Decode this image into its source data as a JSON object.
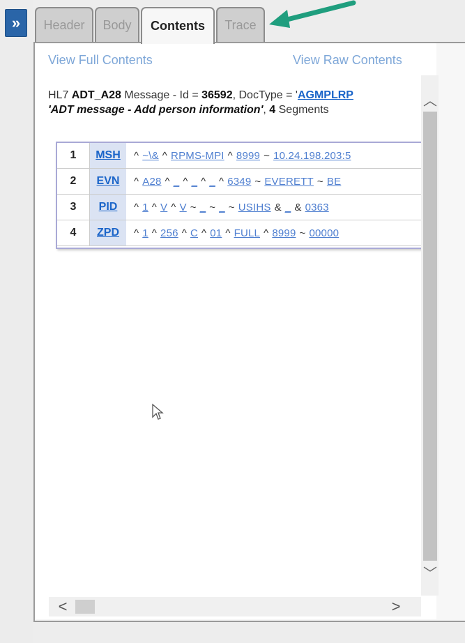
{
  "expand_button": {
    "label": "»"
  },
  "tabs": [
    {
      "label": "Header",
      "active": false
    },
    {
      "label": "Body",
      "active": false
    },
    {
      "label": "Contents",
      "active": true
    },
    {
      "label": "Trace",
      "active": false
    }
  ],
  "links": {
    "view_full": "View Full Contents",
    "view_raw": "View Raw Contents"
  },
  "message": {
    "prefix": "HL7 ",
    "type": "ADT_A28",
    "id_label": " Message - Id = ",
    "id": "36592",
    "doctype_label": ", DocType = '",
    "doctype": "AGMPLRP",
    "description": "'ADT message - Add person information'",
    "count_sep": ", ",
    "segment_count": "4",
    "segments_label": " Segments"
  },
  "segments": [
    {
      "num": "1",
      "name": "MSH",
      "fields": [
        "^",
        "~\\&",
        "^",
        "RPMS-MPI",
        "^",
        "8999",
        "~",
        "10.24.198.203:5"
      ]
    },
    {
      "num": "2",
      "name": "EVN",
      "fields": [
        "^",
        "A28",
        "^",
        "_",
        "^",
        "_",
        "^",
        "_",
        "^",
        "6349",
        "~",
        "EVERETT",
        "~",
        "BE"
      ]
    },
    {
      "num": "3",
      "name": "PID",
      "fields": [
        "^",
        "1",
        "^",
        "V",
        "^",
        "V",
        "~",
        "_",
        "~",
        "_",
        "~",
        "USIHS",
        "&",
        "_",
        "&",
        "0363"
      ]
    },
    {
      "num": "4",
      "name": "ZPD",
      "fields": [
        "^",
        "1",
        "^",
        "256",
        "^",
        "C",
        "^",
        "01",
        "^",
        "FULL",
        "^",
        "8999",
        "~",
        "00000"
      ]
    }
  ],
  "scroll": {
    "up": "︿",
    "down": "﹀",
    "left": "<",
    "right": ">"
  },
  "colors": {
    "accent": "#2a65a8",
    "link": "#1b65c9",
    "arrow": "#1f9e7e"
  }
}
